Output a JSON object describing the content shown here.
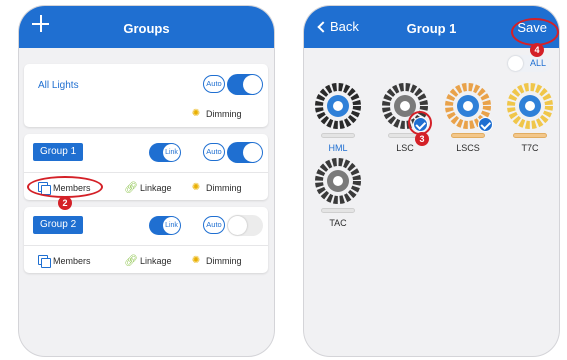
{
  "colors": {
    "accent": "#1f6fd1",
    "annotation": "#d42027",
    "background": "#f1f1f3",
    "lsc_ring": "#e9a24a",
    "t7c_ring": "#f0c64a"
  },
  "left_screen": {
    "header": {
      "title": "Groups",
      "add_icon": "plus-icon"
    },
    "all_lights": {
      "title": "All Lights",
      "auto_label": "Auto",
      "toggle_on": true,
      "dimming_label": "Dimming"
    },
    "groups": [
      {
        "name": "Group 1",
        "link_label": "Link",
        "link_on": true,
        "auto_label": "Auto",
        "toggle_on": true,
        "members_label": "Members",
        "linkage_label": "Linkage",
        "dimming_label": "Dimming"
      },
      {
        "name": "Group 2",
        "link_label": "Link",
        "link_on": true,
        "auto_label": "Auto",
        "toggle_on": false,
        "members_label": "Members",
        "linkage_label": "Linkage",
        "dimming_label": "Dimming"
      }
    ]
  },
  "right_screen": {
    "header": {
      "back_label": "Back",
      "title": "Group 1",
      "save_label": "Save"
    },
    "all_label": "ALL",
    "presets": [
      {
        "name": "HML",
        "selected": false,
        "highlight": true
      },
      {
        "name": "LSC",
        "selected": true,
        "highlight": false
      },
      {
        "name": "LSCS",
        "selected": true,
        "highlight": false
      },
      {
        "name": "T7C",
        "selected": false,
        "highlight": false
      },
      {
        "name": "TAC",
        "selected": false,
        "highlight": false
      }
    ]
  },
  "annotations": {
    "step2": "2",
    "step3": "3",
    "step4": "4"
  }
}
